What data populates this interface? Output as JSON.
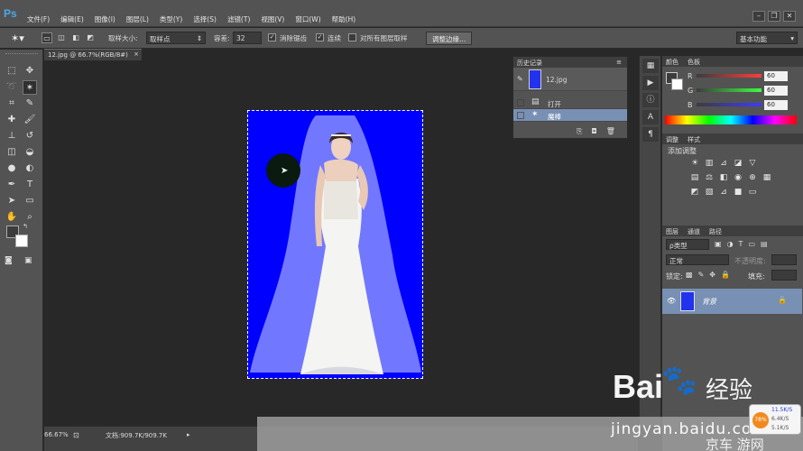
{
  "menubar": {
    "logo": "Ps",
    "menus": [
      "文件(F)",
      "编辑(E)",
      "图像(I)",
      "图层(L)",
      "类型(Y)",
      "选择(S)",
      "滤镜(T)",
      "视图(V)",
      "窗口(W)",
      "帮助(H)"
    ],
    "workspace": "基本功能"
  },
  "options": {
    "sample_size_label": "取样大小:",
    "sample_size_value": "取样点",
    "tolerance_label": "容差:",
    "tolerance_value": "32",
    "antialias_label": "消除锯齿",
    "contiguous_label": "连续",
    "all_layers_label": "对所有图层取样",
    "refine_edge_label": "调整边缘..."
  },
  "document": {
    "tab_title": "12.jpg @ 66.7%(RGB/8#)",
    "tab_close": "×"
  },
  "status": {
    "zoom": "66.67%",
    "doc_size": "文档:909.7K/909.7K"
  },
  "history": {
    "title": "历史记录",
    "snapshot": "12.jpg",
    "steps": [
      "打开",
      "魔棒"
    ]
  },
  "color": {
    "tabs": [
      "颜色",
      "色板"
    ],
    "channels": [
      {
        "label": "R",
        "value": "60"
      },
      {
        "label": "G",
        "value": "60"
      },
      {
        "label": "B",
        "value": "60"
      }
    ]
  },
  "adjustments": {
    "tabs": [
      "调整",
      "样式"
    ],
    "title": "添加调整"
  },
  "layers": {
    "tabs": [
      "图层",
      "通道",
      "路径"
    ],
    "kind_label": "ρ类型",
    "blend_mode": "正常",
    "opacity_label": "不透明度:",
    "lock_label": "锁定:",
    "fill_label": "填充:",
    "layer_name": "背景"
  },
  "watermark": {
    "brand": "Bai",
    "brand2": "经验",
    "url": "jingyan.baidu.com",
    "extra": "京车 游网"
  },
  "net": {
    "percent": "78%",
    "up": "11.5K/S",
    "down1": "6.4K/S",
    "down2": "5.1K/S"
  },
  "colors": {
    "canvas_bg": "#0000ff",
    "accent": "#7790b3"
  }
}
